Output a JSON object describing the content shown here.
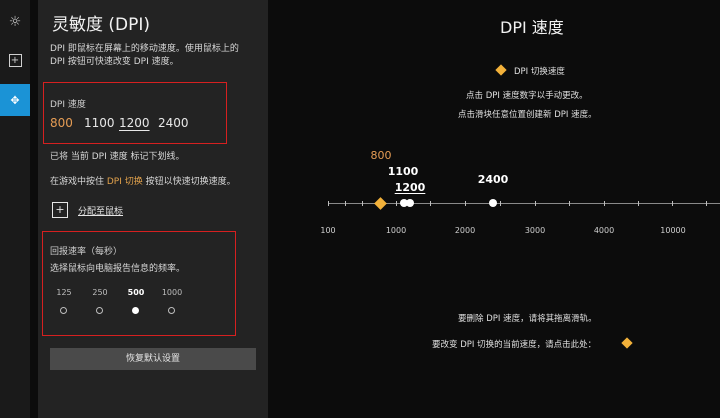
{
  "rail": {
    "icons": [
      "sun-icon",
      "add-icon",
      "move-icon"
    ],
    "active_index": 2
  },
  "panel": {
    "title": "灵敏度 (DPI)",
    "description_lines": [
      "DPI 即鼠标在屏幕上的移动速度。使用鼠标上的",
      "DPI 按钮可快速改变 DPI 速度。"
    ],
    "dpi_section": {
      "label": "DPI 速度",
      "values": [
        "800",
        "1100",
        "1200",
        "2400"
      ],
      "active_value": "800",
      "underlined_value": "1200"
    },
    "note_underline": "已将 当前 DPI 速度 标记下划线。",
    "shift_note": {
      "before": "在游戏中按住 ",
      "highlight": "DPI 切换",
      "after": " 按钮以快速切换速度。"
    },
    "assign_link": "分配至鼠标",
    "report_rate": {
      "label": "回报速率（每秒）",
      "description": "选择鼠标向电脑报告信息的频率。",
      "values": [
        "125",
        "250",
        "500",
        "1000"
      ],
      "selected": "500"
    },
    "reset_button": "恢复默认设置"
  },
  "main": {
    "title": "DPI 速度",
    "legend_label": "DPI 切换速度",
    "instructions": [
      "点击 DPI 速度数字以手动更改。",
      "点击滑块任意位置创建新 DPI 速度。"
    ],
    "axis_ticks": [
      "100",
      "1000",
      "2000",
      "3000",
      "4000",
      "10000"
    ],
    "markers": [
      "800",
      "1100",
      "1200",
      "2400"
    ],
    "delete_hint": "要删除 DPI 速度，请将其拖离滑轨。",
    "shift_hint": "要改变 DPI 切换的当前速度，请点击此处：",
    "colors": {
      "accent": "#e2a24c",
      "active_rail": "#1b93d6",
      "highlight_box": "#d62020"
    }
  }
}
